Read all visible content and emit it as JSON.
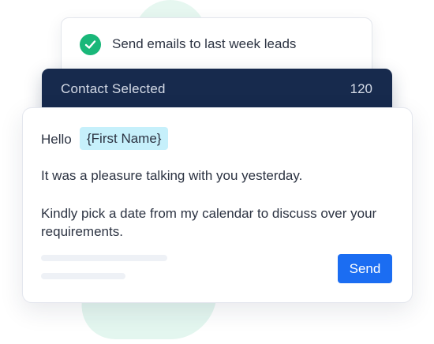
{
  "task": {
    "label": "Send emails to last week leads",
    "status_icon": "check-circle-icon",
    "status_color": "#19b779"
  },
  "contacts": {
    "label": "Contact Selected",
    "count": "120",
    "bar_color": "#172a4d"
  },
  "email": {
    "greeting": "Hello",
    "merge_tag": "{First Name}",
    "line1": "It was a pleasure talking with you yesterday.",
    "paragraph2": "Kindly pick a date from my calendar to discuss over your requirements.",
    "send_label": "Send",
    "accent_color": "#1b6df2",
    "merge_tag_color": "#c6f0fb"
  }
}
